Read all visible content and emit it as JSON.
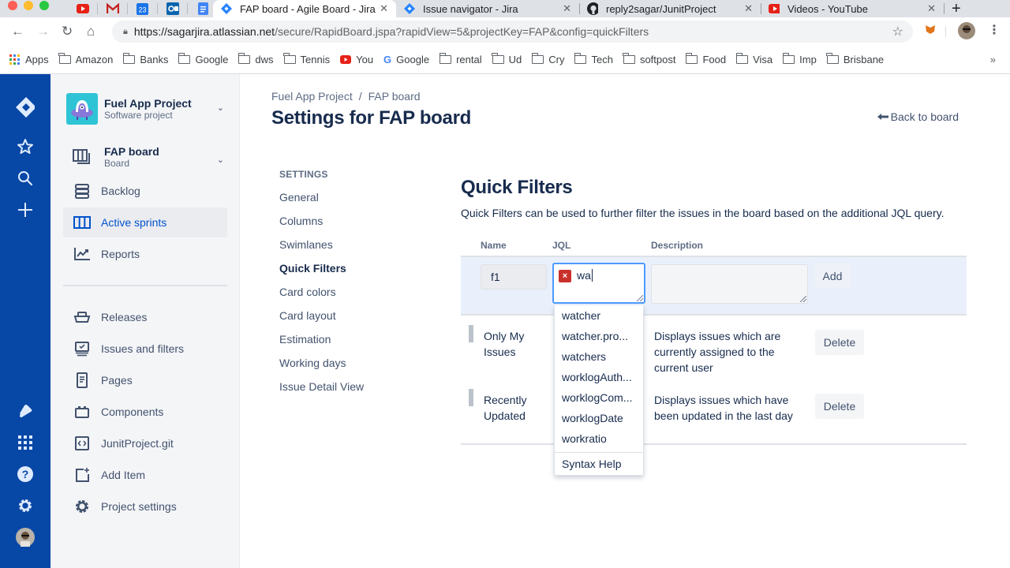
{
  "browser": {
    "tabs": [
      {
        "title": "FAP board - Agile Board - Jira",
        "icon": "jira-icon",
        "active": true
      },
      {
        "title": "Issue navigator - Jira",
        "icon": "jira-icon",
        "active": false
      },
      {
        "title": "reply2sagar/JunitProject",
        "icon": "github-icon",
        "active": false
      },
      {
        "title": "Videos - YouTube",
        "icon": "youtube-icon",
        "active": false
      }
    ],
    "pinned_tabs": [
      "youtube-icon",
      "gmail-icon",
      "calendar-icon",
      "outlook-icon",
      "docs-icon"
    ],
    "url_host": "https://sagarjira.atlassian.net",
    "url_path": "/secure/RapidBoard.jspa?rapidView=5&projectKey=FAP&config=quickFilters",
    "bookmarks": [
      "Apps",
      "Amazon",
      "Banks",
      "Google",
      "dws",
      "Tennis",
      "You",
      "Google",
      "rental",
      "Ud",
      "Cry",
      "Tech",
      "softpost",
      "Food",
      "Visa",
      "Imp",
      "Brisbane"
    ],
    "bookmarks_more": "»"
  },
  "project": {
    "name": "Fuel App Project",
    "type": "Software project",
    "board_name": "FAP board",
    "board_type": "Board"
  },
  "sidebar": {
    "items": [
      {
        "label": "Backlog",
        "icon": "backlog-icon"
      },
      {
        "label": "Active sprints",
        "icon": "board-columns-icon",
        "active": true
      },
      {
        "label": "Reports",
        "icon": "chart-icon"
      },
      {
        "label": "Releases",
        "icon": "ship-icon"
      },
      {
        "label": "Issues and filters",
        "icon": "issues-icon"
      },
      {
        "label": "Pages",
        "icon": "page-icon"
      },
      {
        "label": "Components",
        "icon": "component-icon"
      },
      {
        "label": "JunitProject.git",
        "icon": "code-icon"
      },
      {
        "label": "Add Item",
        "icon": "add-item-icon"
      },
      {
        "label": "Project settings",
        "icon": "gear-icon"
      }
    ]
  },
  "header": {
    "breadcrumb": [
      "Fuel App Project",
      "FAP board"
    ],
    "breadcrumb_sep": "/",
    "title": "Settings for FAP board",
    "back_label": "Back to board",
    "back_arrow": "⟻"
  },
  "settings_nav": {
    "heading": "SETTINGS",
    "items": [
      "General",
      "Columns",
      "Swimlanes",
      "Quick Filters",
      "Card colors",
      "Card layout",
      "Estimation",
      "Working days",
      "Issue Detail View"
    ],
    "selected": "Quick Filters"
  },
  "quick_filters": {
    "title": "Quick Filters",
    "description": "Quick Filters can be used to further filter the issues in the board based on the additional JQL query.",
    "columns": {
      "name": "Name",
      "jql": "JQL",
      "description": "Description"
    },
    "new_filter": {
      "name_value": "f1",
      "jql_value": "wa",
      "jql_error": "×",
      "description_value": "",
      "add_label": "Add"
    },
    "filters": [
      {
        "name": "Only My Issues",
        "description": "Displays issues which are currently assigned to the current user",
        "delete_label": "Delete"
      },
      {
        "name": "Recently Updated",
        "description": "Displays issues which have been updated in the last day",
        "delete_label": "Delete"
      }
    ],
    "autocomplete": {
      "options": [
        "watcher",
        "watcher.pro...",
        "watchers",
        "worklogAuth...",
        "worklogCom...",
        "worklogDate",
        "workratio"
      ],
      "help_label": "Syntax Help"
    }
  }
}
